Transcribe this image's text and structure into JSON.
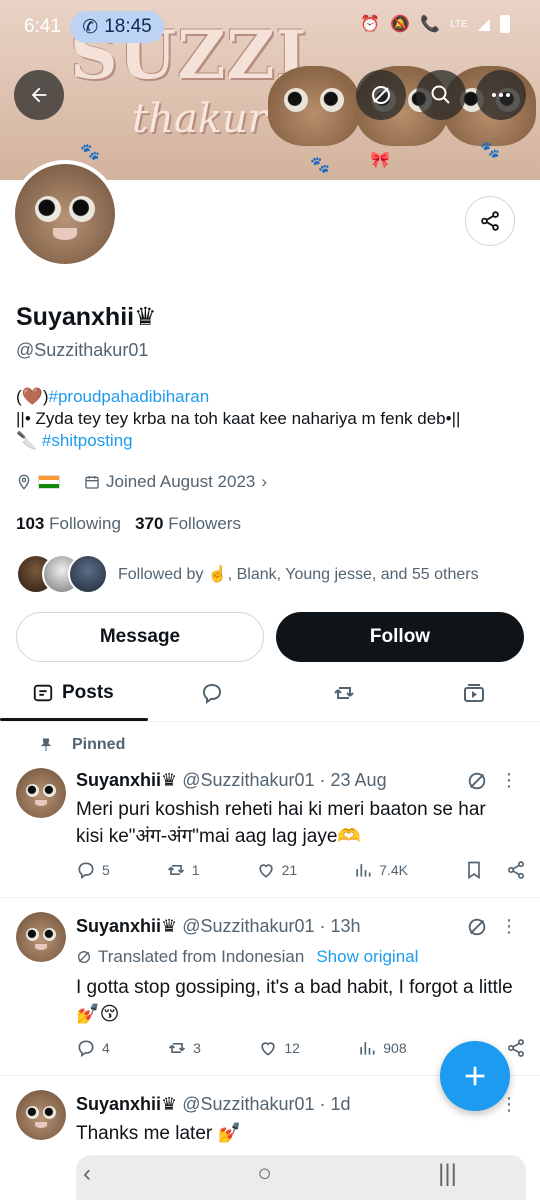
{
  "status_bar": {
    "time": "6:41",
    "call_time": "18:45",
    "network": "LTE"
  },
  "banner": {
    "title": "SUZZI",
    "subtitle": "thakur"
  },
  "profile": {
    "name": "Suyanxhii♛",
    "handle": "@Suzzithakur01",
    "bio_prefix": "(🤎)",
    "bio_hashtag1": "#proudpahadibiharan",
    "bio_line2": "||• Zyda tey tey krba na toh kaat kee nahariya m fenk deb•||",
    "bio_line3_prefix": "🔪 ",
    "bio_hashtag2": "#shitposting",
    "joined": "Joined August 2023",
    "following_count": "103",
    "following_label": "Following",
    "followers_count": "370",
    "followers_label": "Followers",
    "followed_by": "Followed by ☝️, Blank, Young jesse, and 55 others"
  },
  "buttons": {
    "message": "Message",
    "follow": "Follow"
  },
  "tabs": {
    "posts": "Posts"
  },
  "pinned_label": "Pinned",
  "tweets": [
    {
      "name": "Suyanxhii♛",
      "meta": "@Suzzithakur01 · 23 Aug",
      "text": "Meri puri koshish reheti hai ki meri baaton se har kisi ke\"अंग-अंग\"mai aag lag jaye🫶",
      "replies": "5",
      "retweets": "1",
      "likes": "21",
      "views": "7.4K"
    },
    {
      "name": "Suyanxhii♛",
      "meta": "@Suzzithakur01 · 13h",
      "translated": "Translated from Indonesian",
      "show_original": "Show original",
      "text": "I gotta stop gossiping, it's a bad habit, I forgot a little 💅😚",
      "replies": "4",
      "retweets": "3",
      "likes": "12",
      "views": "908"
    },
    {
      "name": "Suyanxhii♛",
      "meta": "@Suzzithakur01 · 1d",
      "text": "Thanks me later 💅"
    }
  ],
  "colors": {
    "accent": "#1d9bf0",
    "text": "#0f1419",
    "muted": "#536471"
  }
}
